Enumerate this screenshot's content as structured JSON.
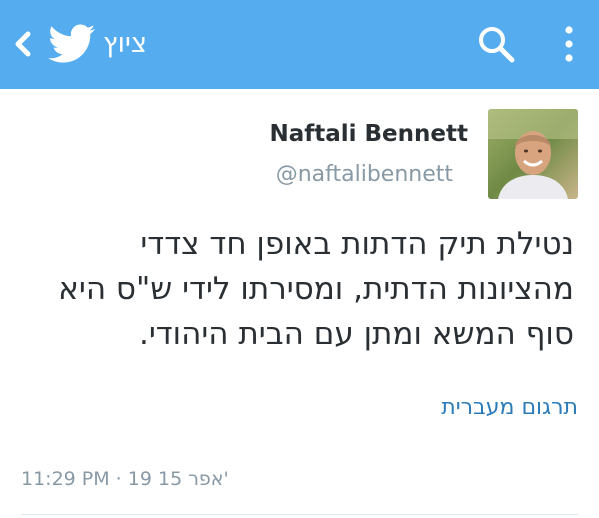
{
  "header": {
    "back_icon": "chevron-left-icon",
    "logo_icon": "twitter-bird-icon",
    "title": "ציוץ",
    "search_icon": "search-icon",
    "more_icon": "more-vertical-icon",
    "background_color": "#55acee"
  },
  "tweet": {
    "author_name": "Naftali Bennett",
    "author_handle": "@naftalibennett",
    "text_lines": [
      "נטילת תיק הדתות באופן חד צדדי",
      "מהציונות הדתית, ומסירתו לידי ש\"ס היא",
      "סוף המשא ומתן עם הבית היהודי."
    ],
    "translate_label": "תרגום מעברית",
    "timestamp": "11:29 PM · 19 15 אפר'"
  },
  "colors": {
    "text_primary": "#292f33",
    "text_secondary": "#8899a6",
    "link": "#2b7bb9",
    "divider": "#e1e8ed"
  }
}
